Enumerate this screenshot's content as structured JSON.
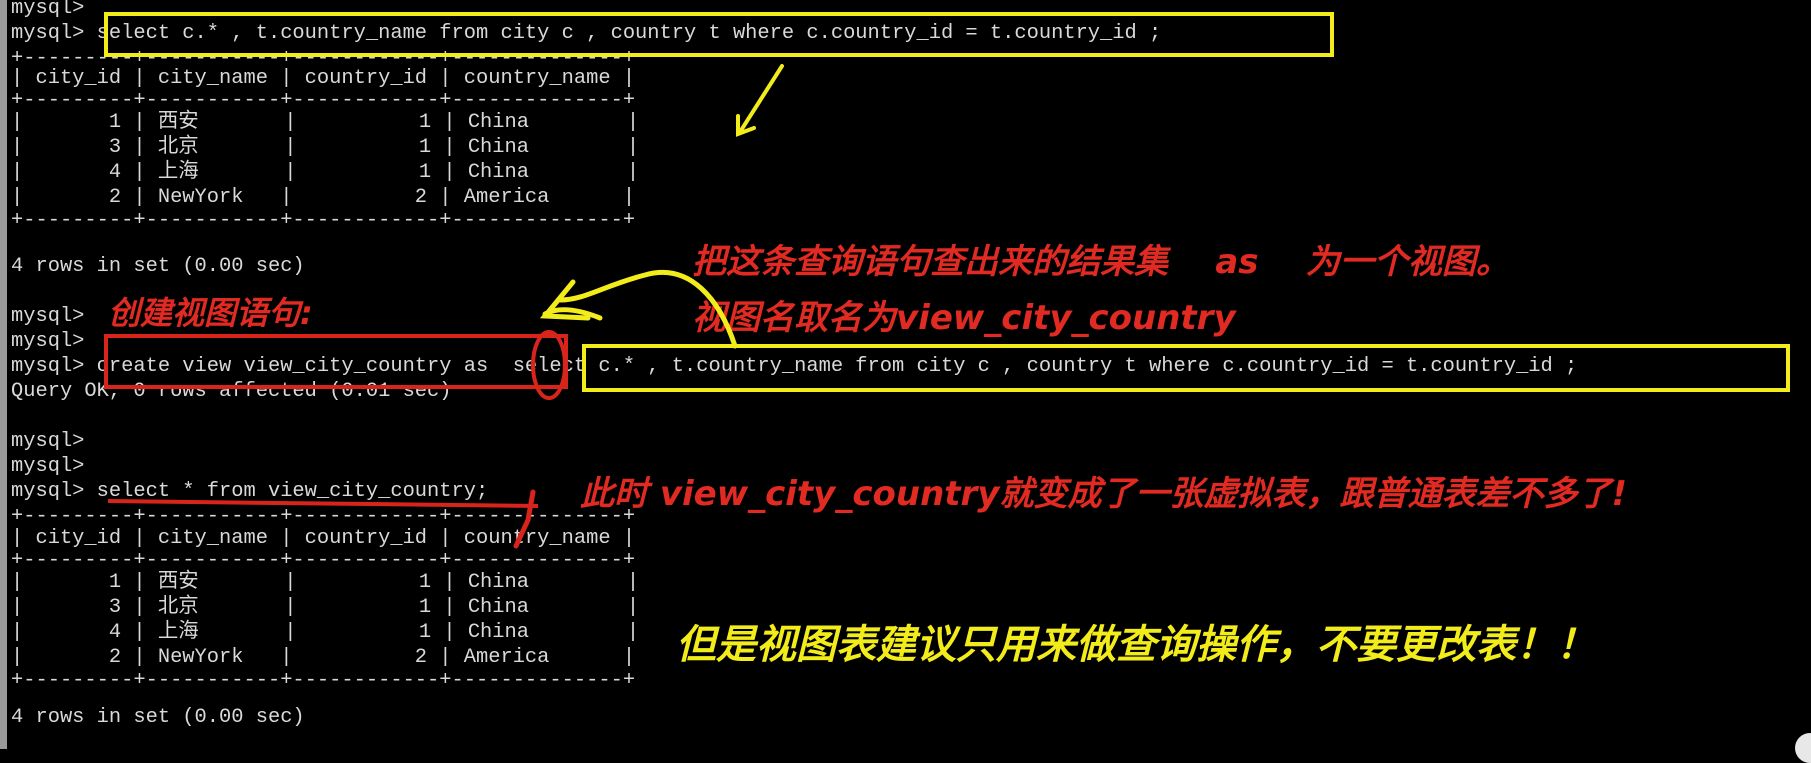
{
  "terminal": {
    "lines": [
      "mysql>",
      "mysql> select c.* , t.country_name from city c , country t where c.country_id = t.country_id ;",
      "+---------+-----------+------------+--------------+",
      "| city_id | city_name | country_id | country_name |",
      "+---------+-----------+------------+--------------+",
      "|       1 | 西安       |          1 | China        |",
      "|       3 | 北京       |          1 | China        |",
      "|       4 | 上海       |          1 | China        |",
      "|       2 | NewYork   |          2 | America      |",
      "+---------+-----------+------------+--------------+",
      "4 rows in set (0.00 sec)",
      "",
      "mysql>",
      "mysql>",
      "mysql> create view view_city_country as  select c.* , t.country_name from city c , country t where c.country_id = t.country_id ;",
      "Query OK, 0 rows affected (0.01 sec)",
      "",
      "mysql>",
      "mysql>",
      "mysql> select * from view_city_country;",
      "+---------+-----------+------------+--------------+",
      "| city_id | city_name | country_id | country_name |",
      "+---------+-----------+------------+--------------+",
      "|       1 | 西安       |          1 | China        |",
      "|       3 | 北京       |          1 | China        |",
      "|       4 | 上海       |          1 | China        |",
      "|       2 | NewYork   |          2 | America      |",
      "+---------+-----------+------------+--------------+",
      "4 rows in set (0.00 sec)"
    ]
  },
  "annotations": {
    "result_set_note": "把这条查询语句查出来的结果集    as    为一个视图。",
    "view_name_note": "视图名取名为view_city_country",
    "create_view_note": "创建视图语句:",
    "virtual_table_note": "此时 view_city_country就变成了一张虚拟表，跟普通表差不多了!",
    "advice_note": "但是视图表建议只用来做查询操作，不要更改表！！"
  },
  "colors": {
    "background": "#000000",
    "terminal_text": "#d9d9d9",
    "highlight_yellow": "#f2ec1a",
    "highlight_red": "#e02a22"
  }
}
